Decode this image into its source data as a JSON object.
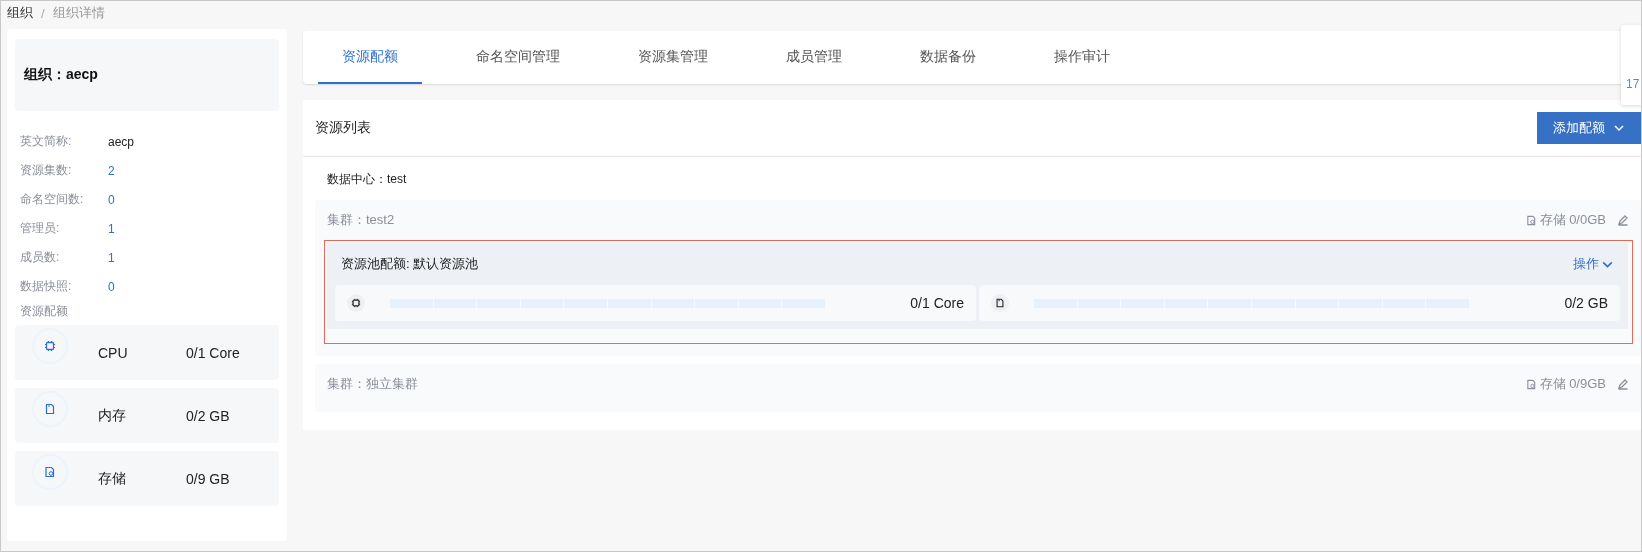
{
  "breadcrumb": {
    "separator": "/",
    "items": [
      {
        "label": "组织",
        "current": false
      },
      {
        "label": "组织详情",
        "current": true
      }
    ]
  },
  "org": {
    "title": "组织：aecp",
    "info": [
      {
        "label": "英文简称:",
        "value": "aecp",
        "link": false
      },
      {
        "label": "资源集数:",
        "value": "2",
        "link": true
      },
      {
        "label": "命名空间数:",
        "value": "0",
        "link": true
      },
      {
        "label": "管理员:",
        "value": "1",
        "link": true
      },
      {
        "label": "成员数:",
        "value": "1",
        "link": true
      },
      {
        "label": "数据快照:",
        "value": "0",
        "link": true
      }
    ],
    "quota_title": "资源配额",
    "quotas": [
      {
        "kind": "cpu",
        "name": "CPU",
        "value": "0/1 Core"
      },
      {
        "kind": "memory",
        "name": "内存",
        "value": "0/2 GB"
      },
      {
        "kind": "storage",
        "name": "存储",
        "value": "0/9 GB"
      }
    ]
  },
  "tabs": [
    {
      "label": "资源配额",
      "selected": true
    },
    {
      "label": "命名空间管理",
      "selected": false
    },
    {
      "label": "资源集管理",
      "selected": false
    },
    {
      "label": "成员管理",
      "selected": false
    },
    {
      "label": "数据备份",
      "selected": false
    },
    {
      "label": "操作审计",
      "selected": false
    }
  ],
  "side_popup": {
    "text": "17"
  },
  "resource_list": {
    "title": "资源列表",
    "add_button": "添加配额",
    "datacenter": "数据中心：test",
    "clusters": [
      {
        "title": "集群：test2",
        "storage": "存储 0/0GB",
        "pools": [
          {
            "title": "资源池配额: 默认资源池",
            "highlighted": true,
            "action": "操作",
            "meters": [
              {
                "kind": "cpu",
                "level": 0,
                "reading": "0/1 Core"
              },
              {
                "kind": "memory",
                "level": 0,
                "reading": "0/2 GB"
              }
            ]
          }
        ]
      },
      {
        "title": "集群：独立集群",
        "storage": "存储 0/9GB"
      }
    ]
  }
}
